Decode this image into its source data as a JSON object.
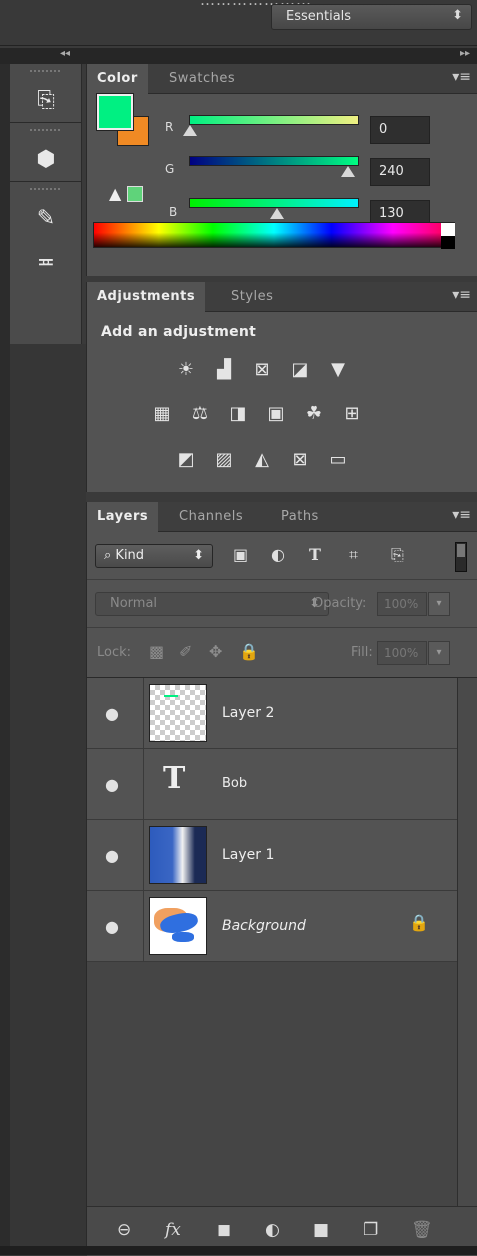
{
  "top": {
    "workspace": "Essentials",
    "workspace_arrows": "⬍",
    "cut_text": "…………………",
    "collapse_left": "◂◂",
    "collapse_right": "▸▸"
  },
  "tools": [
    {
      "icon": "history-icon",
      "glyph": "⎘"
    },
    {
      "icon": "3d-icon",
      "glyph": "⬢"
    },
    {
      "icon": "brush-tool-icon",
      "glyph": "✎"
    },
    {
      "icon": "brush-preset-icon",
      "glyph": "≖"
    }
  ],
  "color": {
    "tabs": [
      "Color",
      "Swatches"
    ],
    "foreground": "#00f082",
    "background": "#f08a24",
    "channels": [
      {
        "label": "R",
        "value": "0"
      },
      {
        "label": "G",
        "value": "240"
      },
      {
        "label": "B",
        "value": "130"
      }
    ],
    "gamut_warning_glyph": "▲"
  },
  "adjustments": {
    "tabs": [
      "Adjustments",
      "Styles"
    ],
    "title": "Add an adjustment",
    "rows": [
      [
        "☀",
        "▟",
        "⊠",
        "◪",
        "▼"
      ],
      [
        "▦",
        "⚖",
        "◨",
        "▣",
        "☘",
        "⊞"
      ],
      [
        "◩",
        "▨",
        "◭",
        "⊠",
        "▭"
      ]
    ]
  },
  "layers": {
    "tabs": [
      "Layers",
      "Channels",
      "Paths"
    ],
    "kind_label": "Kind",
    "kind_search_glyph": "⌕",
    "kind_arrows": "⬍",
    "filter_icons": [
      "▣",
      "◐",
      "T",
      "⌗",
      "⎘"
    ],
    "blend_mode": "Normal",
    "blend_arrows": "⬍",
    "opacity_label": "Opacity:",
    "opacity_value": "100%",
    "lock_label": "Lock:",
    "lock_icons": [
      "▩",
      "✐",
      "✥",
      "🔒"
    ],
    "fill_label": "Fill:",
    "fill_value": "100%",
    "dropdown_arrow": "▾",
    "eye_glyph": "●",
    "lock_glyph": "🔒",
    "text_glyph": "T",
    "rows": [
      {
        "name": "Layer 2",
        "kind": "transparent"
      },
      {
        "name": "Bob",
        "kind": "text"
      },
      {
        "name": "Layer 1",
        "kind": "gradient"
      },
      {
        "name": "Background",
        "kind": "image",
        "locked": true
      }
    ],
    "footer_icons": [
      "⊖",
      "fx",
      "◼",
      "◐",
      "■",
      "❐",
      "🗑"
    ]
  },
  "menu_glyph": "▾≡"
}
